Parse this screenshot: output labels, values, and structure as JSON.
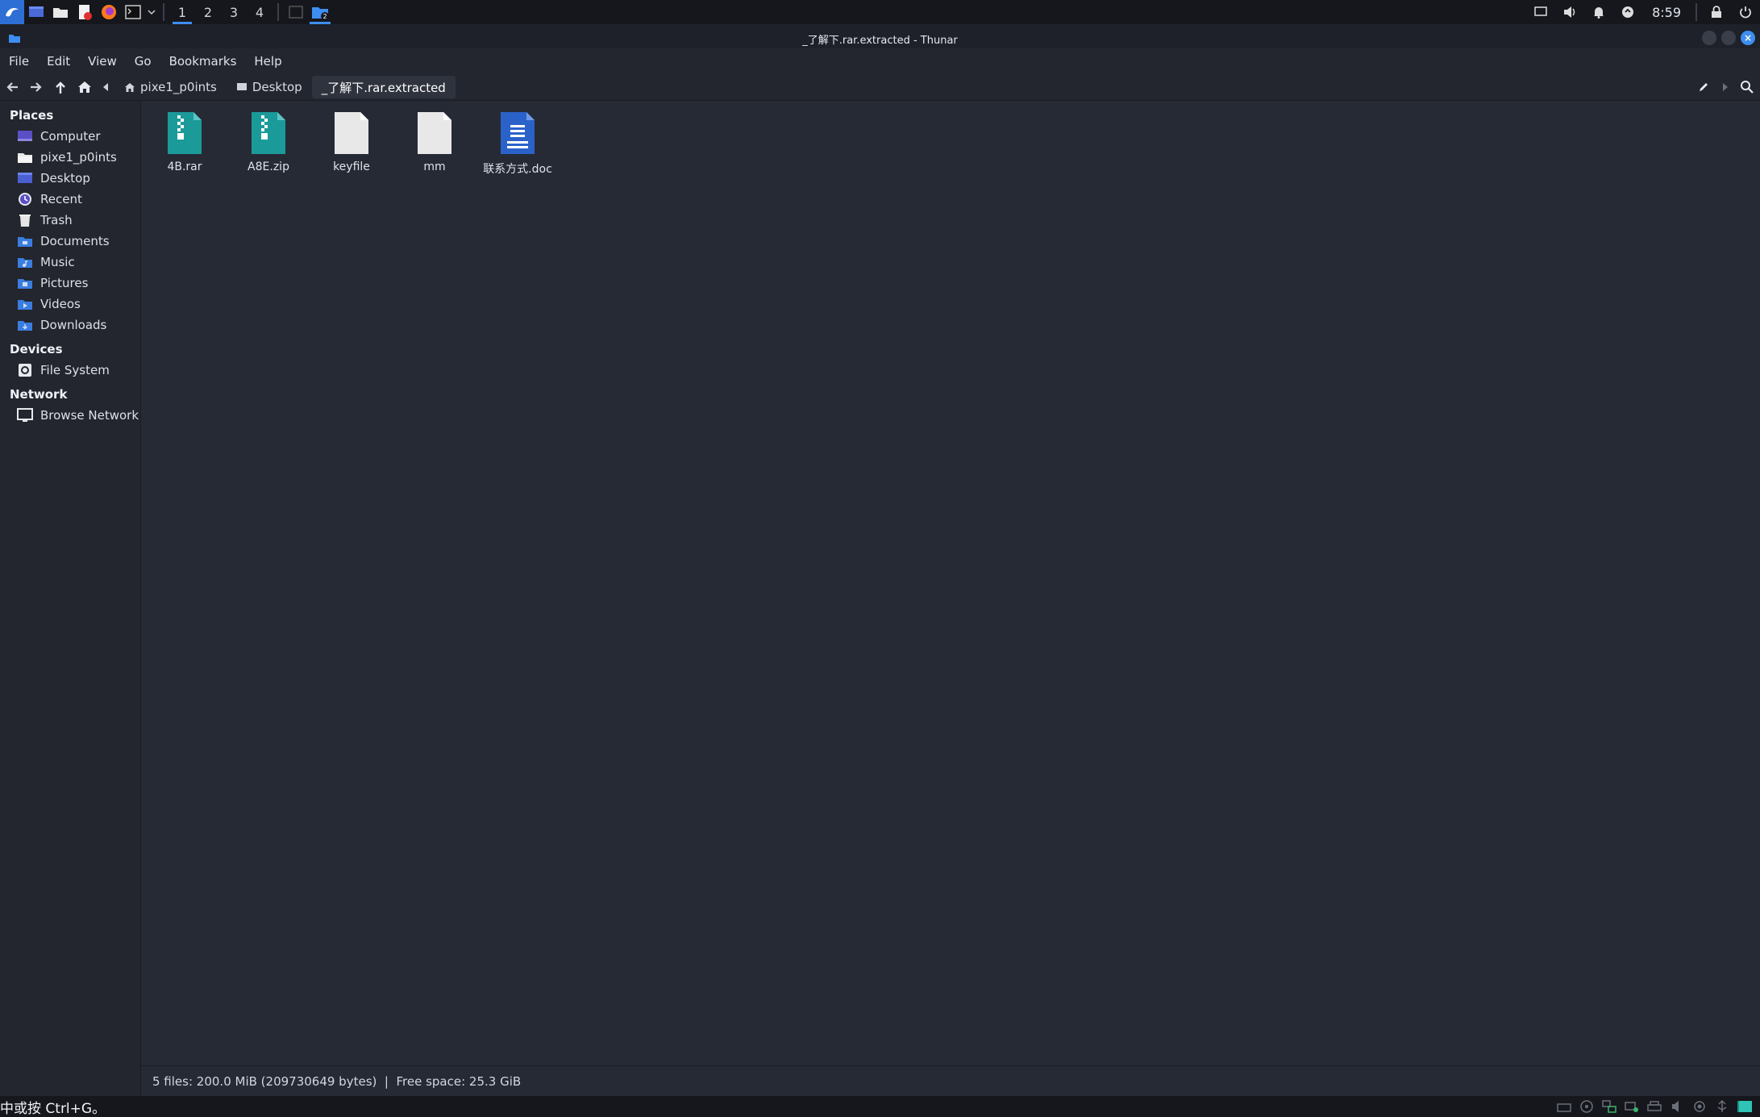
{
  "panel": {
    "workspaces": [
      "1",
      "2",
      "3",
      "4"
    ],
    "active_workspace": "1",
    "clock": "8:59"
  },
  "window": {
    "title": "_了解下.rar.extracted - Thunar"
  },
  "menu": [
    "File",
    "Edit",
    "View",
    "Go",
    "Bookmarks",
    "Help"
  ],
  "breadcrumbs": [
    {
      "label": "pixe1_p0ints",
      "icon": "home-icon"
    },
    {
      "label": "Desktop",
      "icon": "desktop-icon"
    },
    {
      "label": "_了解下.rar.extracted",
      "icon": ""
    }
  ],
  "sidebar": {
    "places_title": "Places",
    "places": [
      {
        "label": "Computer",
        "icon": "computer-icon"
      },
      {
        "label": "pixe1_p0ints",
        "icon": "home-folder-icon"
      },
      {
        "label": "Desktop",
        "icon": "desktop-icon"
      },
      {
        "label": "Recent",
        "icon": "recent-icon"
      },
      {
        "label": "Trash",
        "icon": "trash-icon"
      },
      {
        "label": "Documents",
        "icon": "documents-folder-icon"
      },
      {
        "label": "Music",
        "icon": "music-folder-icon"
      },
      {
        "label": "Pictures",
        "icon": "pictures-folder-icon"
      },
      {
        "label": "Videos",
        "icon": "videos-folder-icon"
      },
      {
        "label": "Downloads",
        "icon": "downloads-folder-icon"
      }
    ],
    "devices_title": "Devices",
    "devices": [
      {
        "label": "File System",
        "icon": "drive-icon"
      }
    ],
    "network_title": "Network",
    "network": [
      {
        "label": "Browse Network",
        "icon": "network-icon"
      }
    ]
  },
  "files": [
    {
      "name": "4B.rar",
      "type": "archive"
    },
    {
      "name": "A8E.zip",
      "type": "archive"
    },
    {
      "name": "keyfile",
      "type": "blank"
    },
    {
      "name": "mm",
      "type": "blank"
    },
    {
      "name": "联系方式.doc",
      "type": "document"
    }
  ],
  "status": {
    "text": "5 files: 200.0 MiB (209730649 bytes)  |  Free space: 25.3 GiB"
  },
  "bottom_hint": "中或按 Ctrl+G。",
  "colors": {
    "accent": "#3d8ef0",
    "archive": "#1b9a9a",
    "document": "#2a62c9",
    "blank": "#e8e8e8"
  }
}
